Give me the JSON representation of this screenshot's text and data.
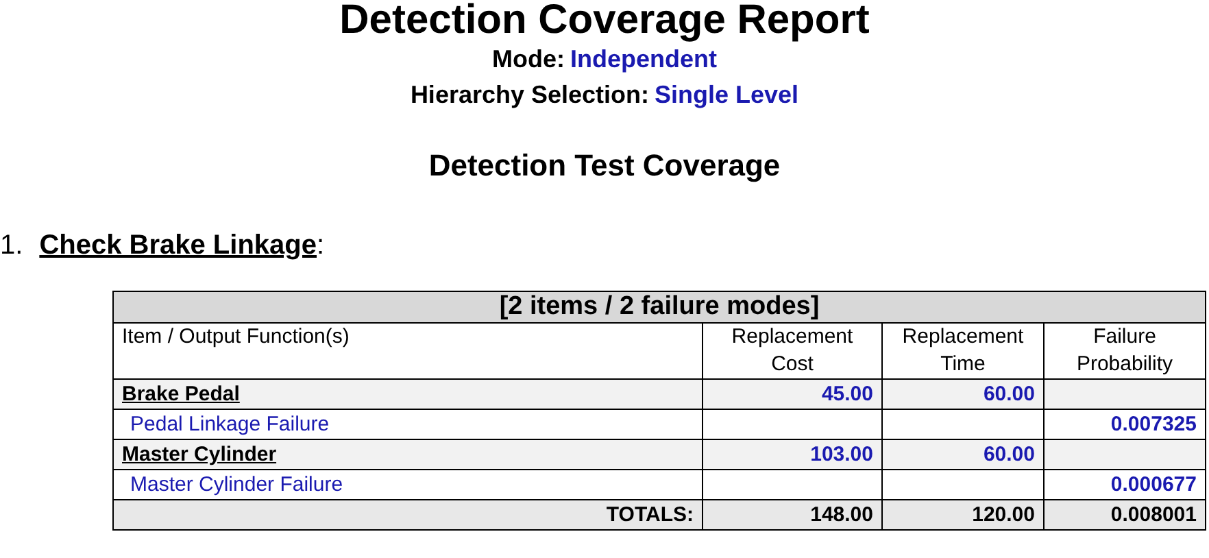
{
  "title": "Detection Coverage Report",
  "settings": [
    {
      "label": "Mode:",
      "value": "Independent"
    },
    {
      "label": "Hierarchy Selection:",
      "value": "Single Level"
    }
  ],
  "subtitle": "Detection Test Coverage",
  "sections": [
    {
      "number": "1.",
      "name": "Check Brake Linkage",
      "suffix": ":",
      "table": {
        "caption": "[2 items / 2 failure modes]",
        "columns": [
          "Item / Output Function(s)",
          "Replacement Cost",
          "Replacement Time",
          "Failure Probability"
        ],
        "rows": [
          {
            "kind": "item",
            "name": "Brake Pedal",
            "cost": "45.00",
            "time": "60.00"
          },
          {
            "kind": "failure",
            "name": "Pedal Linkage Failure",
            "probability": "0.007325"
          },
          {
            "kind": "item",
            "name": "Master Cylinder",
            "cost": "103.00",
            "time": "60.00"
          },
          {
            "kind": "failure",
            "name": "Master Cylinder Failure",
            "probability": "0.000677"
          }
        ],
        "totals": {
          "label": "TOTALS:",
          "cost": "148.00",
          "time": "120.00",
          "probability": "0.008001"
        }
      }
    }
  ]
}
